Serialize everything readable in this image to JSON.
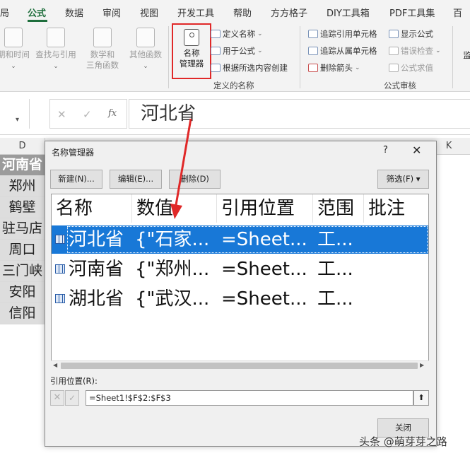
{
  "ribbon": {
    "tabs": [
      {
        "label": "局",
        "active": false
      },
      {
        "label": "公式",
        "active": true
      },
      {
        "label": "数据",
        "active": false
      },
      {
        "label": "审阅",
        "active": false
      },
      {
        "label": "视图",
        "active": false
      },
      {
        "label": "开发工具",
        "active": false
      },
      {
        "label": "帮助",
        "active": false
      },
      {
        "label": "方方格子",
        "active": false
      },
      {
        "label": "DIY工具箱",
        "active": false
      },
      {
        "label": "PDF工具集",
        "active": false
      },
      {
        "label": "百",
        "active": false
      }
    ],
    "function_library": {
      "date_time": "期和时间",
      "lookup": "查找与引用",
      "math_line1": "数学和",
      "math_line2": "三角函数",
      "other": "其他函数"
    },
    "defined_names": {
      "name_manager_line1": "名称",
      "name_manager_line2": "管理器",
      "define_name": "定义名称",
      "use_in_formula": "用于公式",
      "create_from_selection": "根据所选内容创建",
      "group_label": "定义的名称"
    },
    "formula_auditing": {
      "trace_precedents": "追踪引用单元格",
      "trace_dependents": "追踪从属单元格",
      "remove_arrows": "删除箭头",
      "show_formulas": "显示公式",
      "error_checking": "错误检查",
      "evaluate_formula": "公式求值",
      "group_label": "公式审核"
    },
    "watch_window": "监"
  },
  "formula_bar": {
    "cancel_glyph": "✕",
    "enter_glyph": "✓",
    "fx_glyph": "fx",
    "value": "河北省"
  },
  "sheet": {
    "column_d": "D",
    "column_k": "K",
    "cells": [
      "河南省",
      "郑州",
      "鹤壁",
      "驻马店",
      "周口",
      "三门峡",
      "安阳",
      "信阳"
    ]
  },
  "dialog": {
    "title": "名称管理器",
    "help_glyph": "?",
    "close_glyph": "✕",
    "buttons": {
      "new": "新建(N)...",
      "edit": "编辑(E)...",
      "delete": "删除(D)",
      "filter": "筛选(F) ▾"
    },
    "columns": [
      "名称",
      "数值",
      "引用位置",
      "范围",
      "批注"
    ],
    "rows": [
      {
        "name": "河北省",
        "value": "{\"石家...",
        "refers_to": "=Sheet...",
        "scope": "工...",
        "selected": true
      },
      {
        "name": "河南省",
        "value": "{\"郑州...",
        "refers_to": "=Sheet...",
        "scope": "工...",
        "selected": false
      },
      {
        "name": "湖北省",
        "value": "{\"武汉...",
        "refers_to": "=Sheet...",
        "scope": "工...",
        "selected": false
      }
    ],
    "refers_to_label": "引用位置(R):",
    "refers_to_value": "=Sheet1!$F$2:$F$3",
    "close_button": "关闭"
  },
  "watermark": "头条 @萌芽芽之路",
  "colors": {
    "accent_green": "#1e6e3c",
    "annotation_red": "#e02828",
    "selection_blue": "#1878d7"
  }
}
